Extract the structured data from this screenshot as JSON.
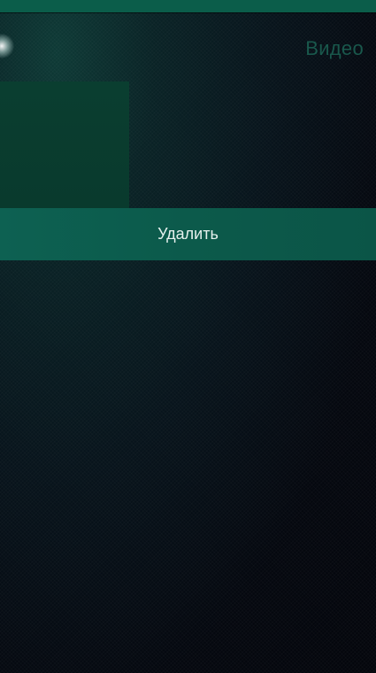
{
  "header": {
    "title": "Видео"
  },
  "context_menu": {
    "items": [
      {
        "label": "Удалить"
      }
    ]
  },
  "colors": {
    "accent": "#0c5a4b",
    "status_strip": "#0b5d4a",
    "header_text": "#19584c",
    "thumbnail": "#0a3e30"
  }
}
